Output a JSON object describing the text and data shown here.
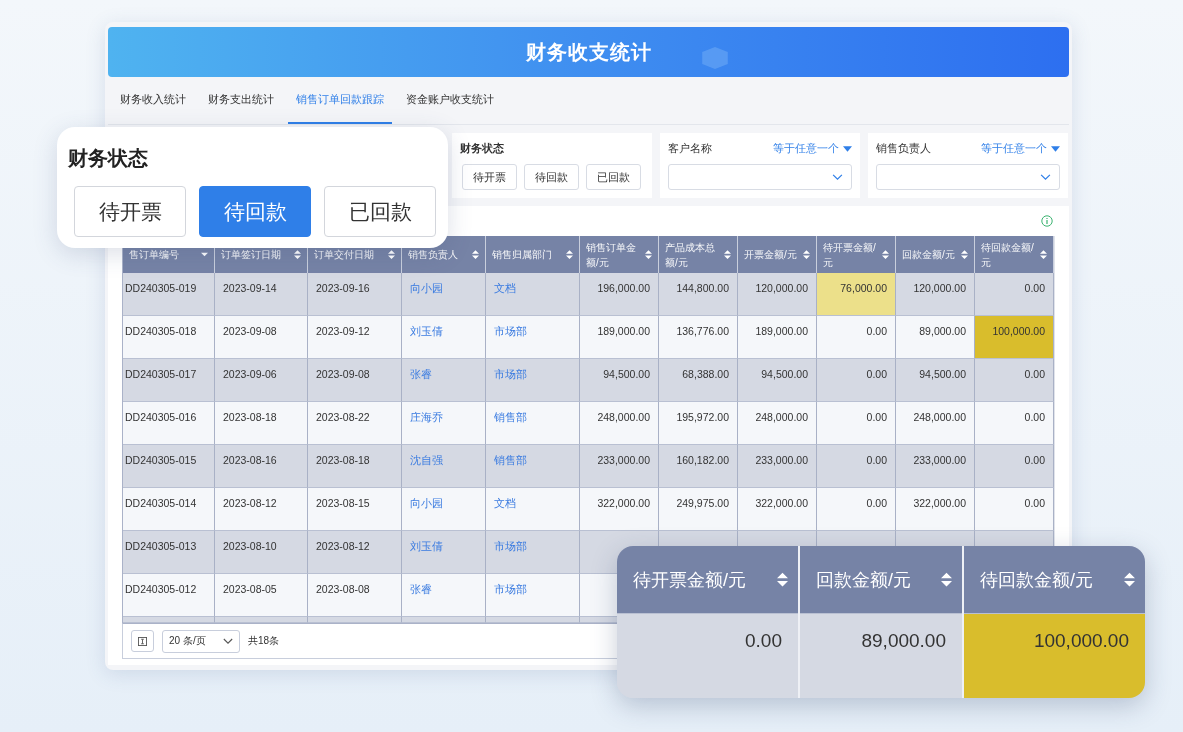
{
  "banner": {
    "title": "财务收支统计"
  },
  "tabs": [
    {
      "label": "财务收入统计",
      "selected": false
    },
    {
      "label": "财务支出统计",
      "selected": false
    },
    {
      "label": "销售订单回款跟踪",
      "selected": true
    },
    {
      "label": "资金账户收支统计",
      "selected": false
    }
  ],
  "filters": [
    {
      "kind": "buttons",
      "label": "财务状态",
      "options": [
        {
          "label": "待开票",
          "selected": false
        },
        {
          "label": "待回款",
          "selected": false
        },
        {
          "label": "已回款",
          "selected": false
        }
      ]
    },
    {
      "kind": "select",
      "label": "客户名称",
      "operator": "等于任意一个"
    },
    {
      "kind": "select",
      "label": "销售负责人",
      "operator": "等于任意一个"
    }
  ],
  "status_popup": {
    "title": "财务状态",
    "options": [
      {
        "label": "待开票",
        "selected": false
      },
      {
        "label": "待回款",
        "selected": true
      },
      {
        "label": "已回款",
        "selected": false
      }
    ]
  },
  "table": {
    "columns": [
      {
        "label": "售订单编号"
      },
      {
        "label": "订单签订日期"
      },
      {
        "label": "订单交付日期"
      },
      {
        "label": "销售负责人"
      },
      {
        "label": "销售归属部门"
      },
      {
        "label": "销售订单金额/元"
      },
      {
        "label": "产品成本总额/元"
      },
      {
        "label": "开票金额/元"
      },
      {
        "label": "待开票金额/元"
      },
      {
        "label": "回款金额/元"
      },
      {
        "label": "待回款金额/元"
      }
    ],
    "rows": [
      {
        "cells": [
          "DD240305-019",
          "2023-09-14",
          "2023-09-16",
          "向小园",
          "文档",
          "196,000.00",
          "144,800.00",
          "120,000.00",
          {
            "text": "76,000.00",
            "color": "#ece08a"
          },
          "120,000.00",
          "0.00"
        ]
      },
      {
        "cells": [
          "DD240305-018",
          "2023-09-08",
          "2023-09-12",
          "刘玉倩",
          "市场部",
          "189,000.00",
          "136,776.00",
          "189,000.00",
          "0.00",
          "89,000.00",
          {
            "text": "100,000.00",
            "color": "#d9bd2c"
          }
        ]
      },
      {
        "cells": [
          "DD240305-017",
          "2023-09-06",
          "2023-09-08",
          "张睿",
          "市场部",
          "94,500.00",
          "68,388.00",
          "94,500.00",
          "0.00",
          "94,500.00",
          "0.00"
        ]
      },
      {
        "cells": [
          "DD240305-016",
          "2023-08-18",
          "2023-08-22",
          "庄海乔",
          "销售部",
          "248,000.00",
          "195,972.00",
          "248,000.00",
          "0.00",
          "248,000.00",
          "0.00"
        ]
      },
      {
        "cells": [
          "DD240305-015",
          "2023-08-16",
          "2023-08-18",
          "沈自强",
          "销售部",
          "233,000.00",
          "160,182.00",
          "233,000.00",
          "0.00",
          "233,000.00",
          "0.00"
        ]
      },
      {
        "cells": [
          "DD240305-014",
          "2023-08-12",
          "2023-08-15",
          "向小园",
          "文档",
          "322,000.00",
          "249,975.00",
          "322,000.00",
          "0.00",
          "322,000.00",
          "0.00"
        ]
      },
      {
        "cells": [
          "DD240305-013",
          "2023-08-10",
          "2023-08-12",
          "刘玉倩",
          "市场部"
        ]
      },
      {
        "cells": [
          "DD240305-012",
          "2023-08-05",
          "2023-08-08",
          "张睿",
          "市场部"
        ]
      }
    ],
    "page_size": "20 条/页",
    "total": "共18条"
  },
  "zoom_card": {
    "columns": [
      {
        "label": "待开票金额/元",
        "value": "0.00"
      },
      {
        "label": "回款金额/元",
        "value": "89,000.00"
      },
      {
        "label": "待回款金额/元",
        "value": "100,000.00",
        "color": "#d9bd2c"
      }
    ]
  }
}
